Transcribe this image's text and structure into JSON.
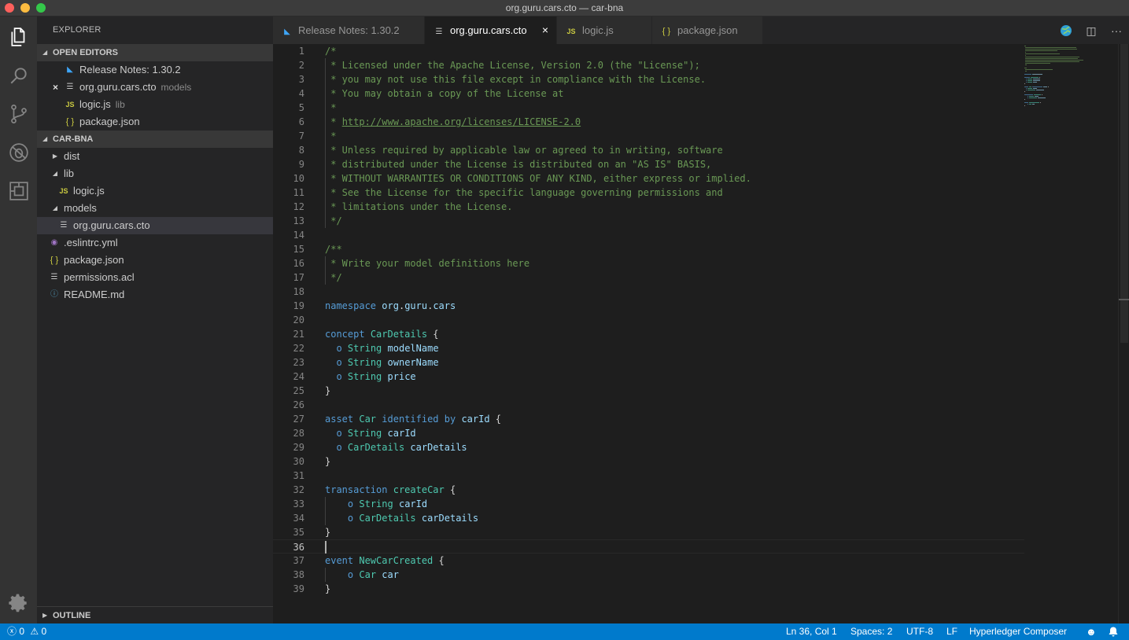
{
  "window": {
    "title": "org.guru.cars.cto — car-bna"
  },
  "activity_bar": [
    {
      "name": "files-icon"
    },
    {
      "name": "search-icon"
    },
    {
      "name": "source-control-icon"
    },
    {
      "name": "debug-icon"
    },
    {
      "name": "extensions-icon"
    },
    {
      "name": "settings-gear-icon"
    }
  ],
  "sidebar": {
    "title": "EXPLORER",
    "open_editors": {
      "header": "OPEN EDITORS",
      "items": [
        {
          "label": "Release Notes: 1.30.2",
          "desc": "",
          "icon": "vscode-icon"
        },
        {
          "label": "org.guru.cars.cto",
          "desc": "models",
          "icon": "lines-icon",
          "close": "×"
        },
        {
          "label": "logic.js",
          "desc": "lib",
          "icon": "js-icon"
        },
        {
          "label": "package.json",
          "desc": "",
          "icon": "json-icon"
        }
      ]
    },
    "project": {
      "header": "CAR-BNA",
      "items": [
        {
          "label": "dist",
          "kind": "folder-collapsed",
          "depth": 0
        },
        {
          "label": "lib",
          "kind": "folder-expanded",
          "depth": 0
        },
        {
          "label": "logic.js",
          "kind": "js-icon",
          "depth": 1
        },
        {
          "label": "models",
          "kind": "folder-expanded",
          "depth": 0
        },
        {
          "label": "org.guru.cars.cto",
          "kind": "lines-icon",
          "depth": 1,
          "selected": true
        },
        {
          "label": ".eslintrc.yml",
          "kind": "eslint-icon",
          "depth": 0
        },
        {
          "label": "package.json",
          "kind": "json-icon",
          "depth": 0
        },
        {
          "label": "permissions.acl",
          "kind": "lines-icon",
          "depth": 0
        },
        {
          "label": "README.md",
          "kind": "info-icon",
          "depth": 0
        }
      ]
    },
    "outline": {
      "header": "OUTLINE"
    }
  },
  "tabs": [
    {
      "label": "Release Notes: 1.30.2",
      "icon": "vscode-icon",
      "active": false
    },
    {
      "label": "org.guru.cars.cto",
      "icon": "lines-icon",
      "active": true,
      "close": "×"
    },
    {
      "label": "logic.js",
      "icon": "js-icon",
      "active": false
    },
    {
      "label": "package.json",
      "icon": "json-icon",
      "active": false
    }
  ],
  "icons": {
    "vscode": "◣",
    "lines": "☰",
    "js": "JS",
    "json": "{ }",
    "eslint": "◉",
    "info": "ⓘ",
    "caret_right": "▶",
    "caret_down": "◢",
    "split": "◫",
    "more": "···"
  },
  "editor": {
    "current_line": 36,
    "lines": [
      [
        [
          "c",
          "/*"
        ]
      ],
      [
        [
          "c",
          " * Licensed under the Apache License, Version 2.0 (the \"License\");"
        ]
      ],
      [
        [
          "c",
          " * you may not use this file except in compliance with the License."
        ]
      ],
      [
        [
          "c",
          " * You may obtain a copy of the License at"
        ]
      ],
      [
        [
          "c",
          " *"
        ]
      ],
      [
        [
          "c",
          " * "
        ],
        [
          "l",
          "http://www.apache.org/licenses/LICENSE-2.0"
        ]
      ],
      [
        [
          "c",
          " *"
        ]
      ],
      [
        [
          "c",
          " * Unless required by applicable law or agreed to in writing, software"
        ]
      ],
      [
        [
          "c",
          " * distributed under the License is distributed on an \"AS IS\" BASIS,"
        ]
      ],
      [
        [
          "c",
          " * WITHOUT WARRANTIES OR CONDITIONS OF ANY KIND, either express or implied."
        ]
      ],
      [
        [
          "c",
          " * See the License for the specific language governing permissions and"
        ]
      ],
      [
        [
          "c",
          " * limitations under the License."
        ]
      ],
      [
        [
          "c",
          " */"
        ]
      ],
      [],
      [
        [
          "c",
          "/**"
        ]
      ],
      [
        [
          "c",
          " * Write your model definitions here"
        ]
      ],
      [
        [
          "c",
          " */"
        ]
      ],
      [],
      [
        [
          "k",
          "namespace"
        ],
        [
          "p",
          " "
        ],
        [
          "n",
          "org"
        ],
        [
          "p",
          "."
        ],
        [
          "n",
          "guru"
        ],
        [
          "p",
          "."
        ],
        [
          "n",
          "cars"
        ]
      ],
      [],
      [
        [
          "k",
          "concept"
        ],
        [
          "p",
          " "
        ],
        [
          "t",
          "CarDetails"
        ],
        [
          "p",
          " {"
        ]
      ],
      [
        [
          "p",
          "  "
        ],
        [
          "k",
          "o"
        ],
        [
          "p",
          " "
        ],
        [
          "t",
          "String"
        ],
        [
          "p",
          " "
        ],
        [
          "n",
          "modelName"
        ]
      ],
      [
        [
          "p",
          "  "
        ],
        [
          "k",
          "o"
        ],
        [
          "p",
          " "
        ],
        [
          "t",
          "String"
        ],
        [
          "p",
          " "
        ],
        [
          "n",
          "ownerName"
        ]
      ],
      [
        [
          "p",
          "  "
        ],
        [
          "k",
          "o"
        ],
        [
          "p",
          " "
        ],
        [
          "t",
          "String"
        ],
        [
          "p",
          " "
        ],
        [
          "n",
          "price"
        ]
      ],
      [
        [
          "p",
          "}"
        ]
      ],
      [],
      [
        [
          "k",
          "asset"
        ],
        [
          "p",
          " "
        ],
        [
          "t",
          "Car"
        ],
        [
          "p",
          " "
        ],
        [
          "k",
          "identified by"
        ],
        [
          "p",
          " "
        ],
        [
          "n",
          "carId"
        ],
        [
          "p",
          " {"
        ]
      ],
      [
        [
          "p",
          "  "
        ],
        [
          "k",
          "o"
        ],
        [
          "p",
          " "
        ],
        [
          "t",
          "String"
        ],
        [
          "p",
          " "
        ],
        [
          "n",
          "carId"
        ]
      ],
      [
        [
          "p",
          "  "
        ],
        [
          "k",
          "o"
        ],
        [
          "p",
          " "
        ],
        [
          "t",
          "CarDetails"
        ],
        [
          "p",
          " "
        ],
        [
          "n",
          "carDetails"
        ]
      ],
      [
        [
          "p",
          "}"
        ]
      ],
      [],
      [
        [
          "k",
          "transaction"
        ],
        [
          "p",
          " "
        ],
        [
          "t",
          "createCar"
        ],
        [
          "p",
          " {"
        ]
      ],
      [
        [
          "p",
          "    "
        ],
        [
          "k",
          "o"
        ],
        [
          "p",
          " "
        ],
        [
          "t",
          "String"
        ],
        [
          "p",
          " "
        ],
        [
          "n",
          "carId"
        ]
      ],
      [
        [
          "p",
          "    "
        ],
        [
          "k",
          "o"
        ],
        [
          "p",
          " "
        ],
        [
          "t",
          "CarDetails"
        ],
        [
          "p",
          " "
        ],
        [
          "n",
          "carDetails"
        ]
      ],
      [
        [
          "p",
          "}"
        ]
      ],
      [],
      [
        [
          "k",
          "event"
        ],
        [
          "p",
          " "
        ],
        [
          "t",
          "NewCarCreated"
        ],
        [
          "p",
          " {"
        ]
      ],
      [
        [
          "p",
          "    "
        ],
        [
          "k",
          "o"
        ],
        [
          "p",
          " "
        ],
        [
          "t",
          "Car"
        ],
        [
          "p",
          " "
        ],
        [
          "n",
          "car"
        ]
      ],
      [
        [
          "p",
          "}"
        ]
      ]
    ]
  },
  "status_bar": {
    "errors": "0",
    "warnings": "0",
    "position": "Ln 36, Col 1",
    "spaces": "Spaces: 2",
    "encoding": "UTF-8",
    "eol": "LF",
    "language": "Hyperledger Composer"
  },
  "colors": {
    "comment": "#6a9955",
    "keyword": "#569cd6",
    "type": "#4ec9b0",
    "name": "#9cdcfe",
    "status_bar": "#007acc"
  }
}
